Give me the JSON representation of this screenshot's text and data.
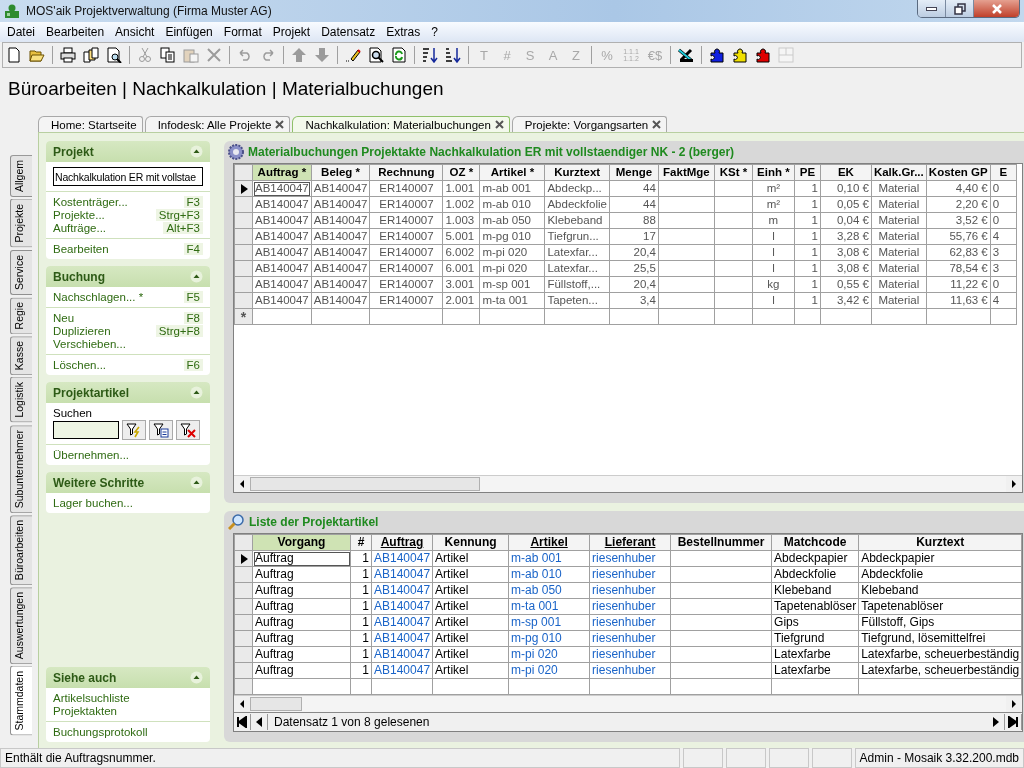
{
  "window": {
    "title": "MOS'aik Projektverwaltung (Firma Muster AG)"
  },
  "menu": [
    {
      "label": "Datei"
    },
    {
      "label": "Bearbeiten"
    },
    {
      "label": "Ansicht"
    },
    {
      "label": "Einfügen"
    },
    {
      "label": "Format"
    },
    {
      "label": "Projekt"
    },
    {
      "label": "Datensatz"
    },
    {
      "label": "Extras"
    },
    {
      "label": "?"
    }
  ],
  "toolbar": [
    {
      "kind": "icon",
      "disabled": false
    },
    {
      "kind": "icon",
      "disabled": false
    },
    {
      "kind": "separator"
    },
    {
      "kind": "icon",
      "disabled": false
    },
    {
      "kind": "icon",
      "disabled": false
    },
    {
      "kind": "icon",
      "disabled": false
    },
    {
      "kind": "separator"
    },
    {
      "kind": "icon",
      "disabled": true
    },
    {
      "kind": "icon",
      "disabled": false
    },
    {
      "kind": "icon",
      "disabled": true
    },
    {
      "kind": "icon",
      "disabled": true
    },
    {
      "kind": "separator"
    },
    {
      "kind": "icon",
      "disabled": true
    },
    {
      "kind": "icon",
      "disabled": true
    },
    {
      "kind": "separator"
    },
    {
      "kind": "icon",
      "disabled": true
    },
    {
      "kind": "icon",
      "disabled": true
    },
    {
      "kind": "separator"
    },
    {
      "kind": "icon",
      "disabled": false
    },
    {
      "kind": "icon",
      "disabled": false
    },
    {
      "kind": "icon",
      "disabled": false
    },
    {
      "kind": "separator"
    },
    {
      "kind": "icon",
      "disabled": false
    },
    {
      "kind": "icon",
      "disabled": false
    },
    {
      "kind": "separator"
    },
    {
      "kind": "text",
      "label": "T",
      "disabled": true
    },
    {
      "kind": "text",
      "label": "#",
      "disabled": true
    },
    {
      "kind": "text",
      "label": "S",
      "disabled": true
    },
    {
      "kind": "text",
      "label": "A",
      "disabled": true
    },
    {
      "kind": "text",
      "label": "Z",
      "disabled": true
    },
    {
      "kind": "separator"
    },
    {
      "kind": "text",
      "label": "%",
      "disabled": true
    },
    {
      "kind": "small",
      "label": "1.1.1 1.1.2",
      "disabled": true
    },
    {
      "kind": "text",
      "label": "€$",
      "disabled": true
    },
    {
      "kind": "separator"
    },
    {
      "kind": "icon",
      "disabled": false
    },
    {
      "kind": "separator"
    },
    {
      "kind": "icon",
      "disabled": false
    },
    {
      "kind": "icon",
      "disabled": false
    },
    {
      "kind": "icon",
      "disabled": false
    },
    {
      "kind": "icon",
      "disabled": true
    }
  ],
  "heading": "Büroarbeiten | Nachkalkulation | Materialbuchungen",
  "side_tabs": [
    {
      "label": "Allgem",
      "selected": false
    },
    {
      "label": "Projekte",
      "selected": false
    },
    {
      "label": "Service",
      "selected": false
    },
    {
      "label": "Regie",
      "selected": false
    },
    {
      "label": "Kasse",
      "selected": false
    },
    {
      "label": "Logistik",
      "selected": false
    },
    {
      "label": "Subunternehmer",
      "selected": false
    },
    {
      "label": "Büroarbeiten",
      "selected": false
    },
    {
      "label": "Auswertungen",
      "selected": false
    },
    {
      "label": "Stammdaten",
      "selected": true
    }
  ],
  "tabs": [
    {
      "label": "Home: Startseite",
      "selected": false,
      "closable": false
    },
    {
      "label": "Infodesk: Alle Projekte",
      "selected": false,
      "closable": true
    },
    {
      "label": "Nachkalkulation: Materialbuchungen",
      "selected": true,
      "closable": true
    },
    {
      "label": "Projekte: Vorgangsarten",
      "selected": false,
      "closable": true
    }
  ],
  "sidebar": [
    {
      "title": "Projekt",
      "expanded": true,
      "groups": [
        [
          {
            "kind": "field",
            "value": "Nachkalkulation ER mit vollstae"
          }
        ],
        [
          {
            "kind": "link",
            "label": "Kostenträger...",
            "shortcut": "F3"
          },
          {
            "kind": "link",
            "label": "Projekte...",
            "shortcut": "Strg+F3"
          },
          {
            "kind": "link",
            "label": "Aufträge...",
            "shortcut": "Alt+F3"
          }
        ],
        [
          {
            "kind": "link",
            "label": "Bearbeiten",
            "shortcut": "F4"
          }
        ]
      ]
    },
    {
      "title": "Buchung",
      "expanded": true,
      "groups": [
        [
          {
            "kind": "link",
            "label": "Nachschlagen... *",
            "shortcut": "F5"
          }
        ],
        [
          {
            "kind": "link",
            "label": "Neu",
            "shortcut": "F8"
          },
          {
            "kind": "link",
            "label": "Duplizieren",
            "shortcut": "Strg+F8"
          },
          {
            "kind": "link",
            "label": "Verschieben..."
          }
        ],
        [
          {
            "kind": "link",
            "label": "Löschen...",
            "shortcut": "F6"
          }
        ]
      ]
    },
    {
      "title": "Projektartikel",
      "expanded": true,
      "groups": [
        [
          {
            "kind": "label",
            "label": "Suchen"
          },
          {
            "kind": "search"
          }
        ],
        [
          {
            "kind": "link",
            "label": "Übernehmen..."
          }
        ]
      ]
    },
    {
      "title": "Weitere Schritte",
      "expanded": true,
      "groups": [
        [
          {
            "kind": "link",
            "label": "Lager buchen..."
          }
        ]
      ]
    },
    {
      "title": "Siehe auch",
      "expanded": true,
      "groups": [
        [
          {
            "kind": "link",
            "label": "Artikelsuchliste"
          },
          {
            "kind": "link",
            "label": "Projektakten"
          }
        ],
        [
          {
            "kind": "link",
            "label": "Buchungsprotokoll"
          }
        ]
      ]
    }
  ],
  "bookings": {
    "title": "Materialbuchungen Projektakte Nachkalkulation ER mit vollstaendiger NK - 2 (berger)",
    "columns": [
      {
        "label": "Auftrag *",
        "sorted": true
      },
      {
        "label": "Beleg *",
        "sorted": false
      },
      {
        "label": "Rechnung",
        "sorted": false
      },
      {
        "label": "OZ *",
        "sorted": false
      },
      {
        "label": "Artikel *",
        "sorted": false
      },
      {
        "label": "Kurztext",
        "sorted": false
      },
      {
        "label": "Menge",
        "sorted": false
      },
      {
        "label": "FaktMge",
        "sorted": false
      },
      {
        "label": "KSt *",
        "sorted": false
      },
      {
        "label": "Einh *",
        "sorted": false
      },
      {
        "label": "PE",
        "sorted": false
      },
      {
        "label": "EK",
        "sorted": false
      },
      {
        "label": "Kalk.Gr...",
        "sorted": false
      },
      {
        "label": "Kosten GP",
        "sorted": false
      },
      {
        "label": "E",
        "sorted": false
      }
    ],
    "rows": [
      {
        "selected": true,
        "cells": [
          "AB140047",
          "AB140047",
          "ER140007",
          "1.001",
          "m-ab 001",
          "Abdeckp...",
          "44",
          null,
          null,
          "m²",
          "1",
          "0,10 €",
          "Material",
          "4,40 €",
          "0"
        ]
      },
      {
        "selected": false,
        "cells": [
          "AB140047",
          "AB140047",
          "ER140007",
          "1.002",
          "m-ab 010",
          "Abdeckfolie",
          "44",
          null,
          null,
          "m²",
          "1",
          "0,05 €",
          "Material",
          "2,20 €",
          "0"
        ]
      },
      {
        "selected": false,
        "cells": [
          "AB140047",
          "AB140047",
          "ER140007",
          "1.003",
          "m-ab 050",
          "Klebeband",
          "88",
          null,
          null,
          "m",
          "1",
          "0,04 €",
          "Material",
          "3,52 €",
          "0"
        ]
      },
      {
        "selected": false,
        "cells": [
          "AB140047",
          "AB140047",
          "ER140007",
          "5.001",
          "m-pg 010",
          "Tiefgrun...",
          "17",
          null,
          null,
          "l",
          "1",
          "3,28 €",
          "Material",
          "55,76 €",
          "4"
        ]
      },
      {
        "selected": false,
        "cells": [
          "AB140047",
          "AB140047",
          "ER140007",
          "6.002",
          "m-pi 020",
          "Latexfar...",
          "20,4",
          null,
          null,
          "l",
          "1",
          "3,08 €",
          "Material",
          "62,83 €",
          "3"
        ]
      },
      {
        "selected": false,
        "cells": [
          "AB140047",
          "AB140047",
          "ER140007",
          "6.001",
          "m-pi 020",
          "Latexfar...",
          "25,5",
          null,
          null,
          "l",
          "1",
          "3,08 €",
          "Material",
          "78,54 €",
          "3"
        ]
      },
      {
        "selected": false,
        "cells": [
          "AB140047",
          "AB140047",
          "ER140007",
          "3.001",
          "m-sp 001",
          "Füllstoff,...",
          "20,4",
          null,
          null,
          "kg",
          "1",
          "0,55 €",
          "Material",
          "11,22 €",
          "0"
        ]
      },
      {
        "selected": false,
        "cells": [
          "AB140047",
          "AB140047",
          "ER140007",
          "2.001",
          "m-ta 001",
          "Tapeten...",
          "3,4",
          null,
          null,
          "l",
          "1",
          "3,42 €",
          "Material",
          "11,63 €",
          "4"
        ]
      }
    ],
    "new_row_marker": "*"
  },
  "articles": {
    "title": "Liste der Projektartikel",
    "columns": [
      {
        "label": "Vorgang",
        "sorted": true,
        "link": false
      },
      {
        "label": "#",
        "sorted": false,
        "link": false
      },
      {
        "label": "Auftrag",
        "sorted": false,
        "link": true
      },
      {
        "label": "Kennung",
        "sorted": false,
        "link": false
      },
      {
        "label": "Artikel",
        "sorted": false,
        "link": true
      },
      {
        "label": "Lieferant",
        "sorted": false,
        "link": true
      },
      {
        "label": "Bestellnummer",
        "sorted": false,
        "link": false
      },
      {
        "label": "Matchcode",
        "sorted": false,
        "link": false
      },
      {
        "label": "Kurztext",
        "sorted": false,
        "link": false
      }
    ],
    "rows": [
      {
        "selected": true,
        "cells": [
          "Auftrag",
          "1",
          "AB140047",
          "Artikel",
          "m-ab 001",
          "riesenhuber",
          null,
          "Abdeckpapier",
          "Abdeckpapier"
        ]
      },
      {
        "selected": false,
        "cells": [
          "Auftrag",
          "1",
          "AB140047",
          "Artikel",
          "m-ab 010",
          "riesenhuber",
          null,
          "Abdeckfolie",
          "Abdeckfolie"
        ]
      },
      {
        "selected": false,
        "cells": [
          "Auftrag",
          "1",
          "AB140047",
          "Artikel",
          "m-ab 050",
          "riesenhuber",
          null,
          "Klebeband",
          "Klebeband"
        ]
      },
      {
        "selected": false,
        "cells": [
          "Auftrag",
          "1",
          "AB140047",
          "Artikel",
          "m-ta 001",
          "riesenhuber",
          null,
          "Tapetenablöser",
          "Tapetenablöser"
        ]
      },
      {
        "selected": false,
        "cells": [
          "Auftrag",
          "1",
          "AB140047",
          "Artikel",
          "m-sp 001",
          "riesenhuber",
          null,
          "Gips",
          "Füllstoff, Gips"
        ]
      },
      {
        "selected": false,
        "cells": [
          "Auftrag",
          "1",
          "AB140047",
          "Artikel",
          "m-pg 010",
          "riesenhuber",
          null,
          "Tiefgrund",
          "Tiefgrund, lösemittelfrei"
        ]
      },
      {
        "selected": false,
        "cells": [
          "Auftrag",
          "1",
          "AB140047",
          "Artikel",
          "m-pi 020",
          "riesenhuber",
          null,
          "Latexfarbe",
          "Latexfarbe, scheuerbeständig"
        ]
      },
      {
        "selected": false,
        "cells": [
          "Auftrag",
          "1",
          "AB140047",
          "Artikel",
          "m-pi 020",
          "riesenhuber",
          null,
          "Latexfarbe",
          "Latexfarbe, scheuerbeständig"
        ]
      }
    ],
    "record_status": "Datensatz 1 von 8 gelesenen"
  },
  "status_bar": {
    "message": "Enthält die Auftragsnummer.",
    "info": "Admin - Mosaik 3.32.200.mdb"
  }
}
